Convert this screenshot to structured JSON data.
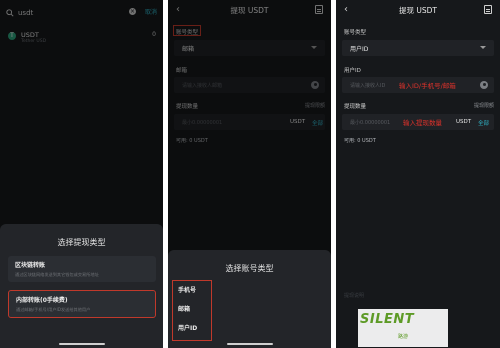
{
  "panel1": {
    "search_text": "usdt",
    "cancel_label": "取消",
    "coin_icon_letter": "T",
    "coin_name": "USDT",
    "coin_fullname": "Tether USD",
    "coin_balance": "0",
    "sheet_title": "选择提现类型",
    "options": [
      {
        "title": "区块链转账",
        "desc": "通过区块链网络发送到其它钱包或交易所地址"
      },
      {
        "title": "内部转账(0手续费)",
        "desc": "通过邮箱/手机号/用户ID发送给其他用户"
      }
    ]
  },
  "panel2": {
    "title": "提现 USDT",
    "account_type_label": "账号类型",
    "account_type_value": "邮箱",
    "email_label": "邮箱",
    "email_placeholder": "请输入接收人邮箱",
    "amount_label": "提现数量",
    "limit_note": "提现限额",
    "amount_placeholder": "最小0.00000001",
    "unit": "USDT",
    "all_label": "全部",
    "available": "可用: 0 USDT",
    "sheet_title": "选择账号类型",
    "account_options": [
      "手机号",
      "邮箱",
      "用户ID"
    ]
  },
  "panel3": {
    "title": "提现 USDT",
    "account_type_label": "账号类型",
    "account_type_value": "用户ID",
    "userid_label": "用户ID",
    "userid_placeholder": "请输入接收人ID",
    "userid_hint": "输入ID/手机号/邮箱",
    "amount_label": "提现数量",
    "limit_note": "提现限额",
    "amount_placeholder": "最小0.00000001",
    "amount_hint": "输入提现数量",
    "unit": "USDT",
    "all_label": "全部",
    "available": "可用: 0 USDT",
    "footer_text": "提现说明"
  },
  "watermark": {
    "logo": "SILENT",
    "sub": "路游"
  },
  "colors": {
    "background": "#16181b",
    "accent": "#2fb3c7",
    "highlight": "#c0392b",
    "annotation": "#e0322b",
    "coin": "#2ca07a"
  }
}
